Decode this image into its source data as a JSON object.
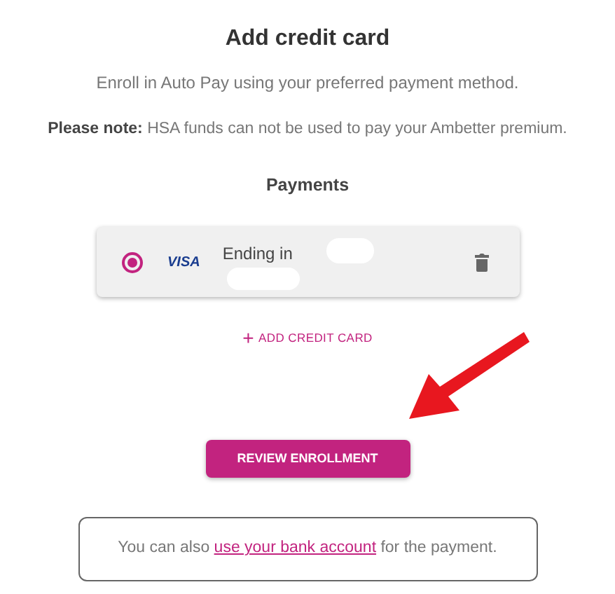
{
  "title": "Add credit card",
  "subtitle": "Enroll in Auto Pay using your preferred payment method.",
  "note": "**Please note:** HSA funds can not be used to pay your Ambetter premium.",
  "payments": {
    "heading": "Payments",
    "cards": [
      {
        "selected": true,
        "brand": "VISA",
        "label": "Ending in"
      }
    ]
  },
  "add_card": {
    "icon": "+",
    "label": "ADD CREDIT CARD"
  },
  "review_button": "REVIEW ENROLLMENT",
  "bank_notice": {
    "before": "You can also",
    "link": "use your bank account",
    "after": "for the payment."
  }
}
